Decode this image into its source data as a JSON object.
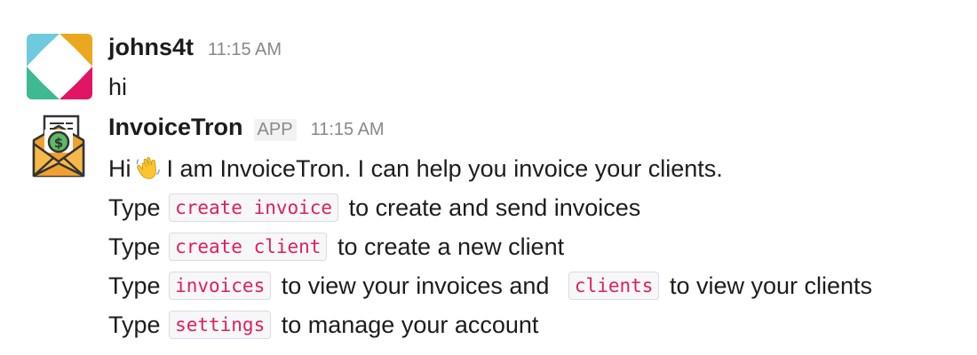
{
  "messages": [
    {
      "author": "johns4t",
      "timestamp": "11:15 AM",
      "avatar_icon": "slack-logo-icon",
      "text": "hi"
    },
    {
      "author": "InvoiceTron",
      "badge": "APP",
      "timestamp": "11:15 AM",
      "avatar_icon": "invoice-envelope-icon",
      "greeting": {
        "before": "Hi",
        "emoji": "waving-hand-emoji",
        "after": "I am InvoiceTron. I can help you invoice your clients."
      },
      "lines": [
        {
          "prefix": "Type",
          "command": "create invoice",
          "suffix": "to create and send invoices"
        },
        {
          "prefix": "Type",
          "command": "create client",
          "suffix": "to create a new client"
        },
        {
          "prefix": "Type",
          "command": "invoices",
          "suffix": "to view your invoices and",
          "command2": "clients",
          "suffix2": "to view your clients"
        },
        {
          "prefix": "Type",
          "command": "settings",
          "suffix": "to manage your account"
        }
      ]
    }
  ],
  "colors": {
    "command_text": "#e01e5a",
    "command_bg": "#f7f7f9",
    "timestamp": "#888888",
    "slack_teal": "#36c5f0",
    "slack_yellow": "#ecb22e",
    "slack_green": "#2eb67d",
    "slack_red": "#e01e5a",
    "envelope_orange": "#f0a030",
    "coin_green": "#5dbb63"
  }
}
